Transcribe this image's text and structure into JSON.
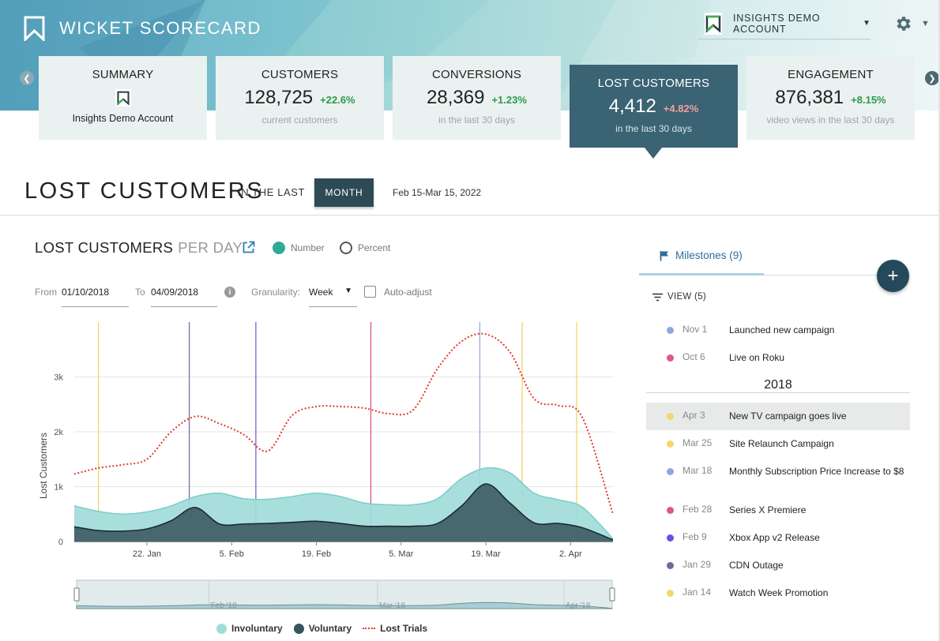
{
  "header": {
    "brand": "WICKET SCORECARD",
    "account_name": "INSIGHTS DEMO ACCOUNT",
    "icons": [
      "wicket-logo-icon",
      "gear-icon",
      "chevron-down-icon",
      "chevron-left-icon",
      "chevron-right-icon"
    ]
  },
  "cards": {
    "summary": {
      "title": "SUMMARY",
      "sub": "Insights Demo Account"
    },
    "customers": {
      "title": "CUSTOMERS",
      "value": "128,725",
      "delta": "+22.6%",
      "sub": "current customers"
    },
    "conversions": {
      "title": "CONVERSIONS",
      "value": "28,369",
      "delta": "+1.23%",
      "sub": "in the last 30 days"
    },
    "lost": {
      "title": "LOST CUSTOMERS",
      "value": "4,412",
      "delta": "+4.82%",
      "sub": "in the last 30 days"
    },
    "engagement": {
      "title": "ENGAGEMENT",
      "value": "876,381",
      "delta": "+8.15%",
      "sub": "video views in the last 30 days"
    }
  },
  "page": {
    "title": "LOST CUSTOMERS",
    "in_the_last": "IN THE LAST",
    "period_button": "MONTH",
    "date_range": "Feb 15-Mar 15, 2022"
  },
  "chart_panel": {
    "title": "LOST CUSTOMERS",
    "title_suffix": "PER DAY",
    "mode_number": "Number",
    "mode_percent": "Percent",
    "from_label": "From",
    "from_value": "01/10/2018",
    "to_label": "To",
    "to_value": "04/09/2018",
    "granularity_label": "Granularity:",
    "granularity_value": "Week",
    "auto_adjust_label": "Auto-adjust",
    "info_glyph": "i"
  },
  "chart_data": {
    "type": "area",
    "ylabel": "Lost Customers",
    "ylim": [
      0,
      4000
    ],
    "yticks": [
      0,
      1000,
      2000,
      3000
    ],
    "ytick_labels": [
      "0",
      "1k",
      "2k",
      "3k"
    ],
    "x_start": "2018-01-10",
    "x_end": "2018-04-09",
    "xtick_labels": [
      {
        "date": "2018-01-22",
        "label": "22. Jan"
      },
      {
        "date": "2018-02-05",
        "label": "5. Feb"
      },
      {
        "date": "2018-02-19",
        "label": "19. Feb"
      },
      {
        "date": "2018-03-05",
        "label": "5. Mar"
      },
      {
        "date": "2018-03-19",
        "label": "19. Mar"
      },
      {
        "date": "2018-04-02",
        "label": "2. Apr"
      }
    ],
    "series": [
      {
        "name": "Involuntary",
        "color": "#9edcd9",
        "points": [
          [
            "2018-01-10",
            650
          ],
          [
            "2018-01-14",
            550
          ],
          [
            "2018-01-18",
            500
          ],
          [
            "2018-01-22",
            540
          ],
          [
            "2018-01-26",
            650
          ],
          [
            "2018-01-30",
            820
          ],
          [
            "2018-02-03",
            880
          ],
          [
            "2018-02-07",
            780
          ],
          [
            "2018-02-11",
            770
          ],
          [
            "2018-02-15",
            820
          ],
          [
            "2018-02-19",
            880
          ],
          [
            "2018-02-23",
            820
          ],
          [
            "2018-02-27",
            700
          ],
          [
            "2018-03-03",
            670
          ],
          [
            "2018-03-07",
            670
          ],
          [
            "2018-03-11",
            780
          ],
          [
            "2018-03-15",
            1150
          ],
          [
            "2018-03-19",
            1340
          ],
          [
            "2018-03-23",
            1250
          ],
          [
            "2018-03-27",
            880
          ],
          [
            "2018-03-31",
            760
          ],
          [
            "2018-04-04",
            620
          ],
          [
            "2018-04-09",
            50
          ]
        ]
      },
      {
        "name": "Voluntary",
        "color": "#37535c",
        "points": [
          [
            "2018-01-10",
            270
          ],
          [
            "2018-01-14",
            200
          ],
          [
            "2018-01-18",
            190
          ],
          [
            "2018-01-22",
            230
          ],
          [
            "2018-01-26",
            380
          ],
          [
            "2018-01-30",
            620
          ],
          [
            "2018-02-03",
            320
          ],
          [
            "2018-02-07",
            320
          ],
          [
            "2018-02-11",
            330
          ],
          [
            "2018-02-15",
            350
          ],
          [
            "2018-02-19",
            370
          ],
          [
            "2018-02-23",
            330
          ],
          [
            "2018-02-27",
            280
          ],
          [
            "2018-03-03",
            280
          ],
          [
            "2018-03-07",
            280
          ],
          [
            "2018-03-11",
            330
          ],
          [
            "2018-03-15",
            650
          ],
          [
            "2018-03-19",
            1050
          ],
          [
            "2018-03-23",
            700
          ],
          [
            "2018-03-27",
            340
          ],
          [
            "2018-03-31",
            330
          ],
          [
            "2018-04-04",
            250
          ],
          [
            "2018-04-09",
            30
          ]
        ]
      },
      {
        "name": "Lost Trials",
        "color": "#e23a2a",
        "style": "dotted",
        "points": [
          [
            "2018-01-10",
            1230
          ],
          [
            "2018-01-14",
            1340
          ],
          [
            "2018-01-18",
            1400
          ],
          [
            "2018-01-22",
            1500
          ],
          [
            "2018-01-26",
            2000
          ],
          [
            "2018-01-30",
            2280
          ],
          [
            "2018-02-03",
            2150
          ],
          [
            "2018-02-07",
            1950
          ],
          [
            "2018-02-11",
            1650
          ],
          [
            "2018-02-15",
            2300
          ],
          [
            "2018-02-19",
            2460
          ],
          [
            "2018-02-23",
            2460
          ],
          [
            "2018-02-27",
            2430
          ],
          [
            "2018-03-03",
            2330
          ],
          [
            "2018-03-07",
            2400
          ],
          [
            "2018-03-11",
            3150
          ],
          [
            "2018-03-15",
            3650
          ],
          [
            "2018-03-19",
            3780
          ],
          [
            "2018-03-23",
            3450
          ],
          [
            "2018-03-27",
            2600
          ],
          [
            "2018-03-31",
            2480
          ],
          [
            "2018-04-04",
            2250
          ],
          [
            "2018-04-09",
            500
          ]
        ]
      }
    ],
    "milestone_lines": [
      {
        "date": "2018-01-14",
        "color": "#f2d66a"
      },
      {
        "date": "2018-01-29",
        "color": "#7a6aae"
      },
      {
        "date": "2018-02-09",
        "color": "#7e5bd9"
      },
      {
        "date": "2018-02-28",
        "color": "#d9558a"
      },
      {
        "date": "2018-03-18",
        "color": "#9aa8e2"
      },
      {
        "date": "2018-03-25",
        "color": "#f2d66a"
      },
      {
        "date": "2018-04-03",
        "color": "#f2d66a"
      }
    ],
    "navigator_labels": [
      {
        "date": "2018-02-01",
        "label": "Feb '18"
      },
      {
        "date": "2018-03-01",
        "label": "Mar '18"
      },
      {
        "date": "2018-04-01",
        "label": "Apr '18"
      }
    ],
    "legend": [
      "Involuntary",
      "Voluntary",
      "Lost Trials"
    ]
  },
  "milestones": {
    "tab_label": "Milestones (9)",
    "view_label": "VIEW (5)",
    "add_glyph": "+",
    "year_label": "2018",
    "recent": [
      {
        "date": "Nov 1",
        "text": "Launched new campaign",
        "color": "#8fa7e0"
      },
      {
        "date": "Oct 6",
        "text": "Live on Roku",
        "color": "#e05590"
      }
    ],
    "items_2018": [
      {
        "date": "Apr 3",
        "text": "New TV campaign goes live",
        "color": "#f2d66a",
        "highlight": true
      },
      {
        "date": "Mar 25",
        "text": "Site Relaunch Campaign",
        "color": "#f2d66a"
      },
      {
        "date": "Mar 18",
        "text": "Monthly Subscription Price Increase to $8",
        "color": "#8fa7e0"
      },
      {
        "date": "Feb 28",
        "text": "Series X Premiere",
        "color": "#e05590"
      },
      {
        "date": "Feb 9",
        "text": "Xbox App v2 Release",
        "color": "#6b4fe0"
      },
      {
        "date": "Jan 29",
        "text": "CDN Outage",
        "color": "#6d6a9e"
      },
      {
        "date": "Jan 14",
        "text": "Watch Week Promotion",
        "color": "#f2d66a"
      }
    ]
  }
}
